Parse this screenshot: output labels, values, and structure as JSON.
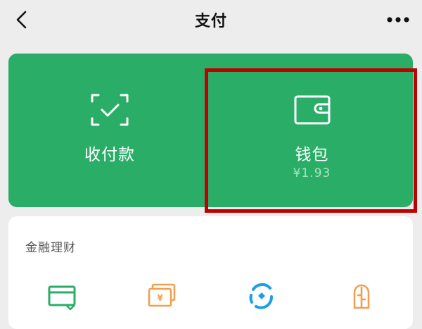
{
  "header": {
    "title": "支付",
    "back_icon": "chevron-left-icon",
    "more_icon": "more-icon"
  },
  "pay_card": {
    "collect": {
      "label": "收付款",
      "icon": "scan-frame-check-icon"
    },
    "wallet": {
      "label": "钱包",
      "balance": "¥1.93",
      "icon": "wallet-icon"
    },
    "highlight_color": "#c00000"
  },
  "finance": {
    "title": "金融理财",
    "icons": [
      {
        "name": "credit-card-icon",
        "color": "#2aae67"
      },
      {
        "name": "cash-stack-icon",
        "color": "#f0a050"
      },
      {
        "name": "fund-circle-icon",
        "color": "#1aa0e6"
      },
      {
        "name": "wealth-icon",
        "color": "#f0a050"
      }
    ]
  },
  "colors": {
    "brand_green": "#2aae67",
    "background": "#ededed"
  }
}
